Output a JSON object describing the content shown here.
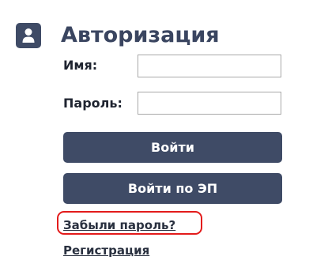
{
  "auth": {
    "title": "Авторизация",
    "user_icon": "user-icon",
    "name_label": "Имя:",
    "name_value": "",
    "password_label": "Пароль:",
    "password_value": "",
    "login_button": "Войти",
    "ep_login_button": "Войти по ЭП",
    "forgot_link": "Забыли пароль?",
    "register_link": "Регистрация"
  },
  "colors": {
    "accent": "#3f4b66",
    "title_text": "#3a4560",
    "highlight": "#e31b1b"
  }
}
